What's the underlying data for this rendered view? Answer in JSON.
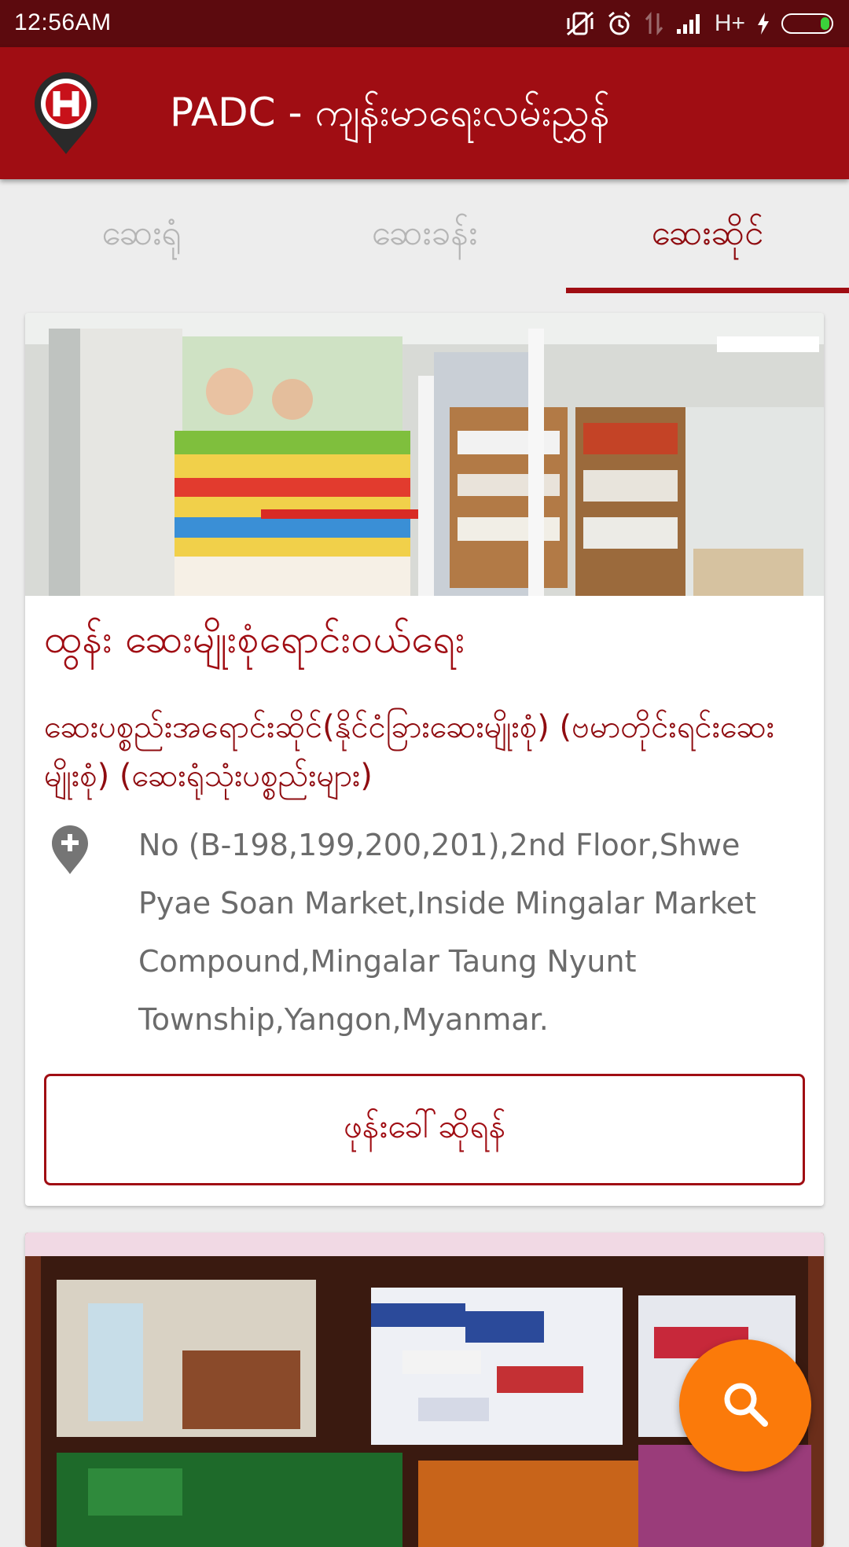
{
  "status_bar": {
    "time": "12:56AM",
    "network_label": "H+",
    "battery_level": 0.2,
    "icons": [
      "vibrate-off-icon",
      "alarm-icon",
      "data-transfer-icon",
      "signal-icon",
      "charging-icon",
      "battery-icon"
    ]
  },
  "app_bar": {
    "title": "PADC - ကျန်းမာရေးလမ်းညွှန်",
    "logo_letter": "H"
  },
  "tabs": [
    {
      "label": "ဆေးရုံ",
      "active": false
    },
    {
      "label": "ဆေးခန်း",
      "active": false
    },
    {
      "label": "ဆေးဆိုင်",
      "active": true
    }
  ],
  "cards": [
    {
      "name": "ထွန်း ဆေးမျိုးစုံရောင်းဝယ်ရေး",
      "description": "ဆေးပစ္စည်းအရောင်းဆိုင်(နိုင်ငံခြားဆေးမျိုးစုံ) (ဗမာတိုင်းရင်းဆေးမျိုးစုံ) (ဆေးရုံသုံးပစ္စည်းများ)",
      "address": "No (B-198,199,200,201),2nd Floor,Shwe Pyae Soan Market,Inside Mingalar Market Compound,Mingalar Taung Nyunt Township,Yangon,Myanmar.",
      "call_label": "ဖုန်းခေါ်ဆိုရန်"
    }
  ],
  "fab": {
    "icon": "search-icon"
  },
  "colors": {
    "status_bar": "#5c0a0e",
    "primary": "#a00d13",
    "background": "#ededed",
    "fab": "#fb7a0a",
    "inactive_tab": "#b5b5b5"
  }
}
